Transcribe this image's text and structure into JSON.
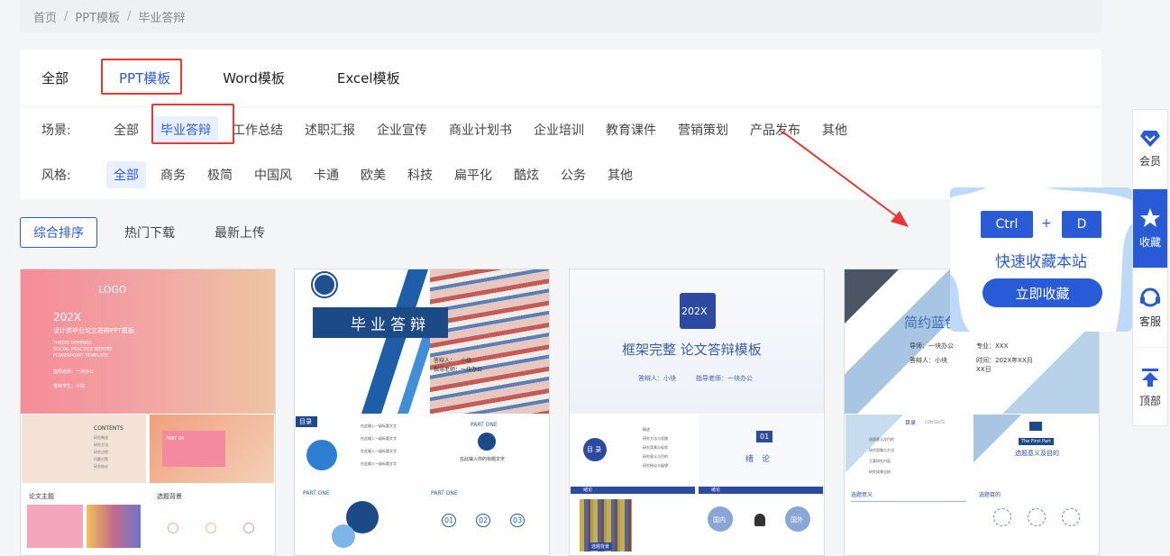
{
  "breadcrumb": {
    "home": "首页",
    "category": "PPT模板",
    "current": "毕业答辩",
    "separator": "/"
  },
  "type_tabs": [
    {
      "label": "全部"
    },
    {
      "label": "PPT模板"
    },
    {
      "label": "Word模板"
    },
    {
      "label": "Excel模板"
    }
  ],
  "filters": {
    "scene": {
      "label": "场景:",
      "options": [
        "全部",
        "毕业答辩",
        "工作总结",
        "述职汇报",
        "企业宣传",
        "商业计划书",
        "企业培训",
        "教育课件",
        "营销策划",
        "产品发布",
        "其他"
      ],
      "selected": "毕业答辩"
    },
    "style": {
      "label": "风格:",
      "options": [
        "全部",
        "商务",
        "极简",
        "中国风",
        "卡通",
        "欧美",
        "科技",
        "扁平化",
        "酷炫",
        "公务",
        "其他"
      ],
      "selected": "全部"
    }
  },
  "sort": {
    "options": [
      "综合排序",
      "热门下载",
      "最新上传"
    ],
    "selected": "综合排序"
  },
  "cards": [
    {
      "logo": "LOGO",
      "year": "202X",
      "subtitle": "设计类毕业论文答辩PPT模板",
      "eng1": "THESIS DEFENSE",
      "eng2": "SOCIAL PRACTICE REPORT",
      "eng3": "POWERPOINT TEMPLATE",
      "teacher": "指导老师：一块办公",
      "student": "答辩学生：小块",
      "contents": "CONTENTS",
      "part": "PART 04",
      "thumb_title_a": "论文主题",
      "thumb_title_b": "选题背景",
      "toc": [
        "研究概述",
        "研究方法",
        "研究过程",
        "问题对策",
        "研究结论"
      ]
    },
    {
      "title": "毕业答辩",
      "reporter_label": "答辩人：",
      "reporter": "小块",
      "advisor_label": "指导老师：",
      "advisor": "一块办公",
      "toc_label": "目录",
      "part": "PART ONE",
      "part_subtitle": "在此输入你的标题文字",
      "toc_items": [
        "在此输入一级标题文字",
        "在此输入一级标题文字",
        "在此输入一级标题文字",
        "在此输入一级标题文字"
      ],
      "steps": [
        "01",
        "02",
        "03"
      ]
    },
    {
      "badge": "202X",
      "title": "框架完整 论文答辩模板",
      "reporter": "答辩人：小块",
      "advisor": "指导老师：一块办公",
      "toc_label": "目 录",
      "section_no": "01",
      "section_title": "绪　论",
      "toc_items": [
        "概述",
        "研究方法与思路",
        "研究背景与现状",
        "研究意义与目的",
        "研究结论与展望"
      ],
      "bottom_tag": "绪论",
      "bottom_label": "选题背景",
      "domestic": "国内",
      "foreign": "国外"
    },
    {
      "title": "简约蓝色",
      "advisor": "导师：一块办公",
      "major": "专业：XXX",
      "reporter": "答辩人：小块",
      "time": "时间：202X年XX月XX日",
      "toc_label": "目录",
      "toc_en": "CONTENTS",
      "first_part": "The First Part",
      "first_title": "选题意义及目的",
      "sec_a": "选题意义",
      "sec_b": "选题目的",
      "toc_items": [
        "选题意义及目的",
        "研究思路与方法",
        "主要研究内容",
        "研究成果总结"
      ]
    }
  ],
  "promo": {
    "key1": "Ctrl",
    "plus": "+",
    "key2": "D",
    "title": "快速收藏本站",
    "button": "立即收藏"
  },
  "rail": [
    {
      "label": "会员",
      "icon": "diamond-icon"
    },
    {
      "label": "收藏",
      "icon": "star-icon"
    },
    {
      "label": "客服",
      "icon": "headset-icon"
    },
    {
      "label": "顶部",
      "icon": "arrow-top-icon"
    }
  ],
  "colors": {
    "accent": "#2a5bd7",
    "highlight_box": "#e53935",
    "arrow": "#e53935"
  }
}
